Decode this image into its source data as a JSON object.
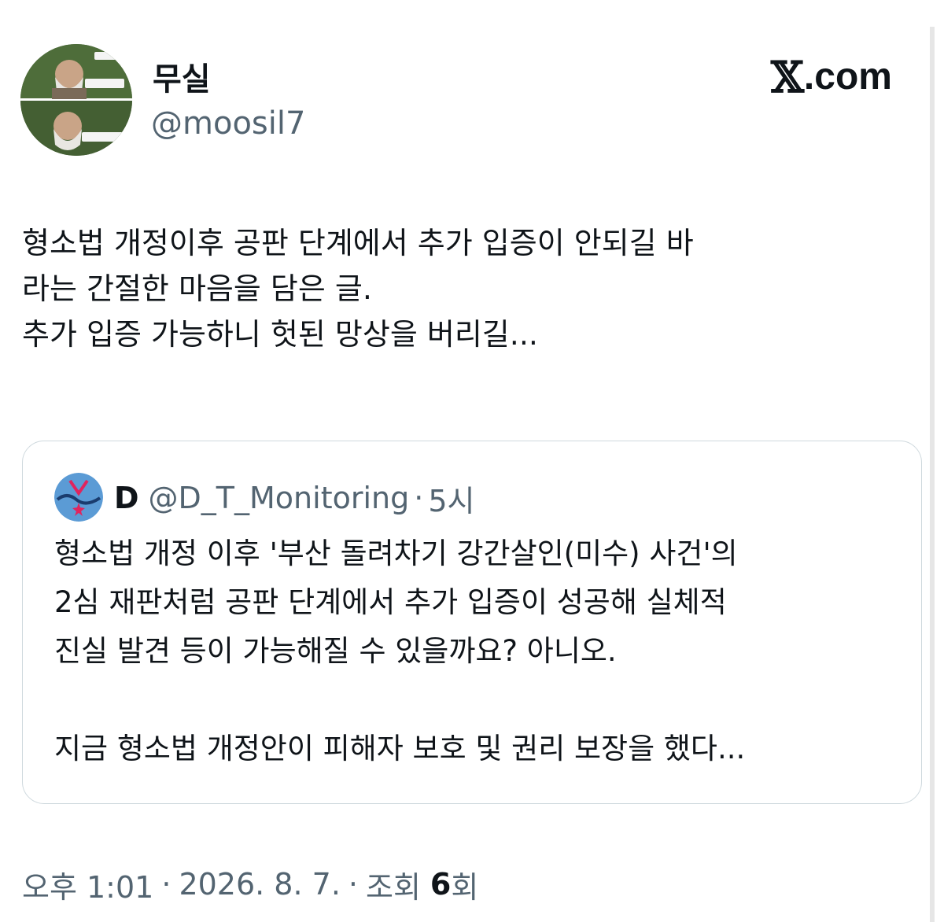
{
  "author": {
    "display_name": "무실",
    "handle": "@moosil7",
    "avatar_icon": "avatar-photo-icon"
  },
  "brand": {
    "mark": "𝕏",
    "text": ".com"
  },
  "tweet": {
    "lines": [
      "형소법 개정이후 공판 단계에서 추가 입증이 안되길 바",
      "라는 간절한 마음을 담은 글.",
      "추가 입증 가능하니 헛된 망상을 버리길..."
    ]
  },
  "quote": {
    "display_name": "D",
    "handle": "@D_T_Monitoring",
    "dot": "·",
    "time": "5시",
    "avatar_icon": "monitoring-logo-icon",
    "lines": [
      "형소법 개정 이후 '부산 돌려차기 강간살인(미수) 사건'의",
      "2심 재판처럼 공판 단계에서 추가 입증이 성공해 실체적",
      "진실 발견 등이 가능해질 수 있을까요? 아니오.",
      "",
      "지금 형소법 개정안이 피해자 보호 및 권리 보장을 했다..."
    ]
  },
  "meta": {
    "time": "오후 1:01",
    "sep1": "·",
    "date": "2026. 8. 7.",
    "sep2": "·",
    "views_label": "조회",
    "views_count": "6",
    "views_suffix": "회"
  },
  "colors": {
    "text_primary": "#0f1419",
    "text_secondary": "#536471",
    "border": "#cfd9de",
    "quote_logo_bg": "#5b9bd5",
    "quote_logo_accent": "#e0245e"
  }
}
